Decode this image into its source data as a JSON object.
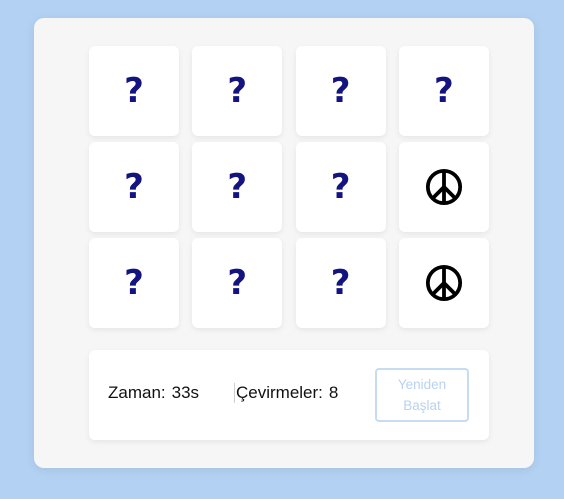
{
  "board": {
    "cards": [
      {
        "state": "hidden",
        "symbol": "?"
      },
      {
        "state": "hidden",
        "symbol": "?"
      },
      {
        "state": "hidden",
        "symbol": "?"
      },
      {
        "state": "hidden",
        "symbol": "?"
      },
      {
        "state": "hidden",
        "symbol": "?"
      },
      {
        "state": "hidden",
        "symbol": "?"
      },
      {
        "state": "hidden",
        "symbol": "?"
      },
      {
        "state": "revealed",
        "icon": "peace-sign-icon"
      },
      {
        "state": "hidden",
        "symbol": "?"
      },
      {
        "state": "hidden",
        "symbol": "?"
      },
      {
        "state": "hidden",
        "symbol": "?"
      },
      {
        "state": "revealed",
        "icon": "peace-sign-icon"
      }
    ]
  },
  "status": {
    "time_label": "Zaman:",
    "time_value": "33s",
    "moves_label": "Çevirmeler:",
    "moves_value": "8",
    "restart_label": "Yeniden Başlat"
  },
  "colors": {
    "background": "#b3d1f2",
    "panel": "#f6f6f6",
    "card": "#ffffff",
    "question_mark": "#141480",
    "restart_border": "#c6dcf3",
    "restart_text": "#b9d2ef"
  }
}
